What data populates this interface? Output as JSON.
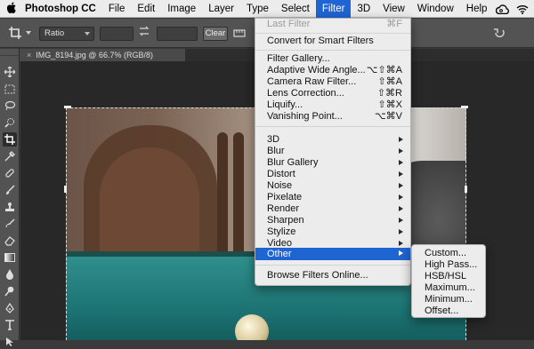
{
  "menubar": {
    "items": [
      "Photoshop CC",
      "File",
      "Edit",
      "Image",
      "Layer",
      "Type",
      "Select",
      "Filter",
      "3D",
      "View",
      "Window",
      "Help"
    ],
    "active": "Filter"
  },
  "options": {
    "ratio_value": "Ratio",
    "clear_label": "Clear"
  },
  "document": {
    "tab_label": "IMG_8194.jpg @ 66.7% (RGB/8)",
    "tab_close": "×"
  },
  "filter_menu": {
    "last_filter": {
      "label": "Last Filter",
      "shortcut": "⌘F"
    },
    "convert": "Convert for Smart Filters",
    "gallery": [
      {
        "label": "Filter Gallery...",
        "shortcut": ""
      },
      {
        "label": "Adaptive Wide Angle...",
        "shortcut": "⌥⇧⌘A"
      },
      {
        "label": "Camera Raw Filter...",
        "shortcut": "⇧⌘A"
      },
      {
        "label": "Lens Correction...",
        "shortcut": "⇧⌘R"
      },
      {
        "label": "Liquify...",
        "shortcut": "⇧⌘X"
      },
      {
        "label": "Vanishing Point...",
        "shortcut": "⌥⌘V"
      }
    ],
    "submenus": [
      "3D",
      "Blur",
      "Blur Gallery",
      "Distort",
      "Noise",
      "Pixelate",
      "Render",
      "Sharpen",
      "Stylize",
      "Video",
      "Other"
    ],
    "highlighted": "Other",
    "browse": "Browse Filters Online..."
  },
  "other_submenu": {
    "items": [
      "Custom...",
      "High Pass...",
      "HSB/HSL",
      "Maximum...",
      "Minimum...",
      "Offset..."
    ]
  },
  "icons": {
    "apple": "apple-icon",
    "crop": "crop-icon",
    "swap": "swap-icon",
    "straighten": "straighten-icon",
    "undo": "undo-icon",
    "creative_cloud": "creative-cloud-icon",
    "wifi": "wifi-icon"
  },
  "colors": {
    "menu_highlight": "#1f64d3",
    "panel": "#535353"
  }
}
